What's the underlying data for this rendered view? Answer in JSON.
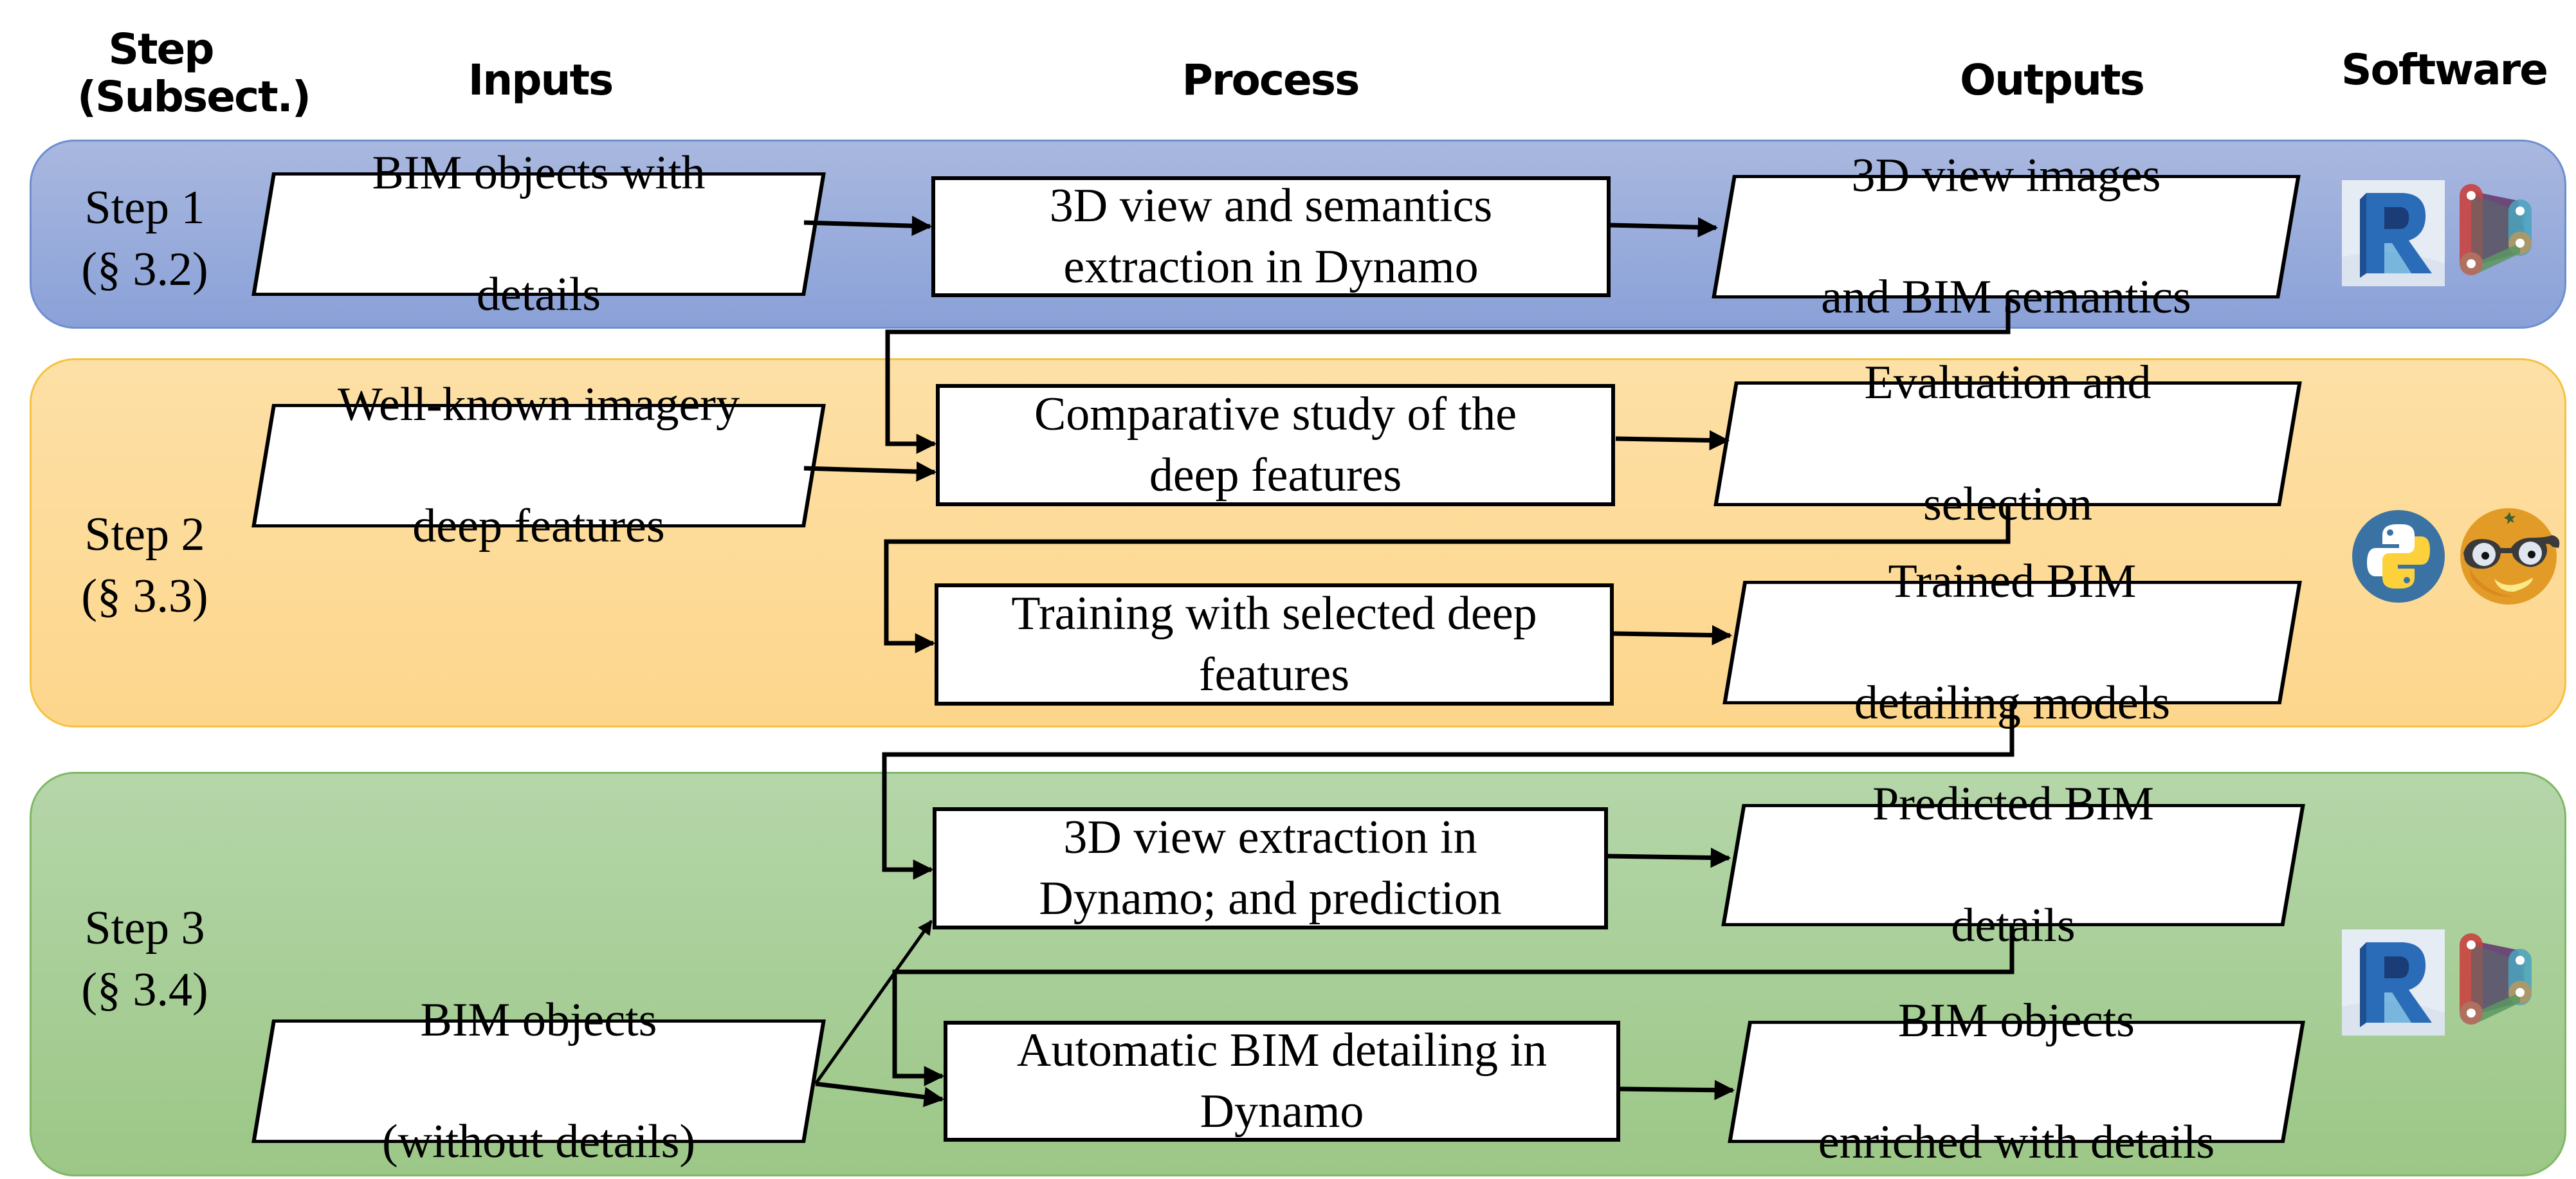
{
  "headers": {
    "step": "Step\n(Subsect.)",
    "step_line1": "Step",
    "step_line2": "(Subsect.)",
    "inputs": "Inputs",
    "process": "Process",
    "outputs": "Outputs",
    "software": "Software"
  },
  "steps": [
    {
      "label": "Step 1",
      "subsection": "(§ 3.2)",
      "color": "#8faadc",
      "inputs": [
        {
          "line1": "BIM objects with",
          "line2": "details"
        }
      ],
      "processes": [
        {
          "line1": "3D view and semantics",
          "line2": "extraction in Dynamo"
        }
      ],
      "outputs": [
        {
          "line1": "3D view images",
          "line2": "and BIM semantics"
        }
      ],
      "software": [
        "revit-icon",
        "dynamo-icon"
      ]
    },
    {
      "label": "Step 2",
      "subsection": "(§ 3.3)",
      "color": "#ffd98f",
      "inputs": [
        {
          "line1": "Well-known imagery",
          "line2": "deep features"
        }
      ],
      "processes": [
        {
          "line1": "Comparative study of the",
          "line2": "deep features"
        },
        {
          "line1": "Training with selected deep",
          "line2": "features"
        }
      ],
      "outputs": [
        {
          "line1": "Evaluation and",
          "line2": "selection"
        },
        {
          "line1": "Trained BIM",
          "line2": "detailing models"
        }
      ],
      "software": [
        "python-icon",
        "orange-icon"
      ]
    },
    {
      "label": "Step 3",
      "subsection": "(§ 3.4)",
      "color": "#a9d18e",
      "inputs": [
        {
          "line1": "BIM objects",
          "line2": "(without details)"
        }
      ],
      "processes": [
        {
          "line1": "3D view extraction in",
          "line2": "Dynamo; and prediction"
        },
        {
          "line1": "Automatic BIM detailing in",
          "line2": "Dynamo"
        }
      ],
      "outputs": [
        {
          "line1": "Predicted BIM",
          "line2": "details"
        },
        {
          "line1": "BIM objects",
          "line2": "enriched with details"
        }
      ],
      "software": [
        "revit-icon",
        "dynamo-icon"
      ]
    }
  ]
}
